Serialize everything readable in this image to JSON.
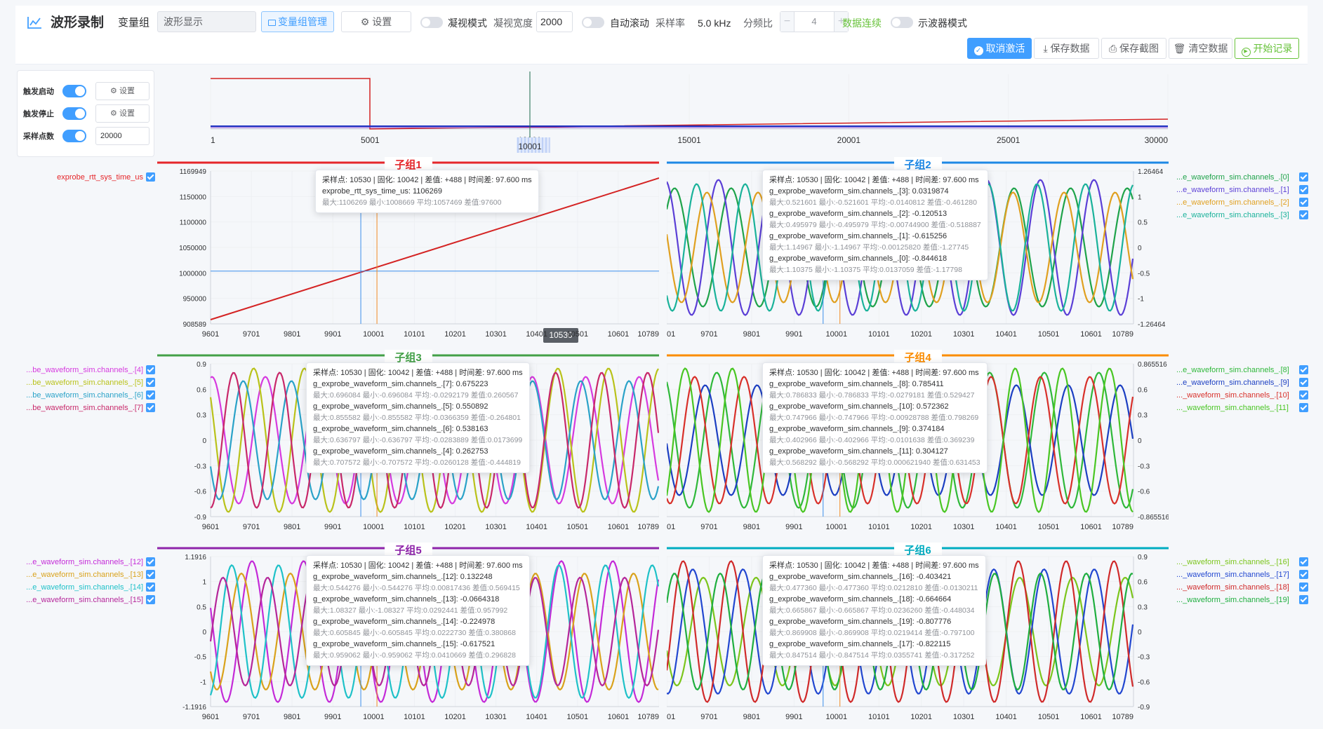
{
  "header": {
    "title": "波形录制",
    "group_label": "变量组",
    "group_value": "波形显示",
    "manage_label": "变量组管理",
    "settings_label": "设置",
    "peek_mode_label": "凝视模式",
    "peek_width_label": "凝视宽度",
    "peek_width_value": "2000",
    "auto_scroll_label": "自动滚动",
    "rate_label": "采样率",
    "rate_value": "5.0 kHz",
    "div_label": "分频比",
    "div_value": "4",
    "continuous_label": "数据连续",
    "scope_mode_label": "示波器模式",
    "cancel_label": "取消激活",
    "save_data_label": "保存数据",
    "save_shot_label": "保存截图",
    "clear_label": "清空数据",
    "start_label": "开始记录"
  },
  "trigger": {
    "start_label": "触发启动",
    "stop_label": "触发停止",
    "points_label": "采样点数",
    "points_value": "20000",
    "btn_label": "设置"
  },
  "overview": {
    "ticks": [
      "1",
      "5001",
      "10001",
      "15001",
      "20001",
      "25001",
      "30000"
    ]
  },
  "cursor_label": "10530",
  "colors": {
    "primary": "#409eff",
    "success": "#67c23a",
    "group1": "#e5262a",
    "group2": "#1e88e5",
    "group3": "#43a047",
    "group4": "#fb8c00",
    "group5": "#8e24aa",
    "group6": "#00acc1"
  },
  "groups": [
    {
      "title": "子组1",
      "yticks": [
        "1169949",
        "1150000",
        "1100000",
        "1050000",
        "1000000",
        "950000",
        "908589"
      ],
      "xticks": [
        "9601",
        "9701",
        "9801",
        "9901",
        "10001",
        "10101",
        "10201",
        "10301",
        "10401",
        "10501",
        "10601",
        "10789"
      ],
      "legend": [
        {
          "label": "exprobe_rtt_sys_time_us",
          "color": "#e5262a"
        }
      ],
      "tooltip": {
        "header": "采样点: 10530 | 固化: 10042 | 差值: +488 | 时间差: 97.600 ms",
        "items": [
          {
            "name": "exprobe_rtt_sys_time_us: 1106269",
            "stat": "最大:1106269 最小:1008669 平均:1057469 差值:97600"
          }
        ]
      }
    },
    {
      "title": "子组2",
      "yticks": [
        "1.26464",
        "1",
        "0.5",
        "0",
        "-0.5",
        "-1",
        "-1.26464"
      ],
      "xticks": [
        "9601",
        "9701",
        "9801",
        "9901",
        "10001",
        "10101",
        "10201",
        "10301",
        "10401",
        "10501",
        "10601",
        "10789"
      ],
      "legend": [
        {
          "label": "...e_waveform_sim.channels_.[0]",
          "color": "#1fa34a"
        },
        {
          "label": "...e_waveform_sim.channels_.[1]",
          "color": "#5b3fd6"
        },
        {
          "label": "...e_waveform_sim.channels_.[2]",
          "color": "#e0a020"
        },
        {
          "label": "...e_waveform_sim.channels_.[3]",
          "color": "#1ab29a"
        }
      ],
      "tooltip": {
        "header": "采样点: 10530 | 固化: 10042 | 差值: +488 | 时间差: 97.600 ms",
        "items": [
          {
            "name": "g_exprobe_waveform_sim.channels_.[3]: 0.0319874",
            "stat": "最大:0.521601 最小:-0.521601 平均:-0.0140812 差值:-0.461280"
          },
          {
            "name": "g_exprobe_waveform_sim.channels_.[2]: -0.120513",
            "stat": "最大:0.495979 最小:-0.495979 平均:-0.00744900 差值:-0.518887"
          },
          {
            "name": "g_exprobe_waveform_sim.channels_.[1]: -0.615256",
            "stat": "最大:1.14967 最小:-1.14967 平均:-0.00125820 差值:-1.27745"
          },
          {
            "name": "g_exprobe_waveform_sim.channels_.[0]: -0.844618",
            "stat": "最大:1.10375 最小:-1.10375 平均:0.0137059 差值:-1.17798"
          }
        ]
      }
    },
    {
      "title": "子组3",
      "yticks": [
        "0.9",
        "0.6",
        "0.3",
        "0",
        "-0.3",
        "-0.6",
        "-0.9"
      ],
      "xticks": [
        "9601",
        "9701",
        "9801",
        "9901",
        "10001",
        "10101",
        "10201",
        "10301",
        "10401",
        "10501",
        "10601",
        "10789"
      ],
      "legend": [
        {
          "label": "...be_waveform_sim.channels_.[4]",
          "color": "#d63adf"
        },
        {
          "label": "...be_waveform_sim.channels_.[5]",
          "color": "#b9c21a"
        },
        {
          "label": "...be_waveform_sim.channels_.[6]",
          "color": "#2aa2c8"
        },
        {
          "label": "...be_waveform_sim.channels_.[7]",
          "color": "#c8286a"
        }
      ],
      "tooltip": {
        "header": "采样点: 10530 | 固化: 10042 | 差值: +488 | 时间差: 97.600 ms",
        "items": [
          {
            "name": "g_exprobe_waveform_sim.channels_.[7]: 0.675223",
            "stat": "最大:0.696084 最小:-0.696084 平均:-0.0292179 差值:0.260567"
          },
          {
            "name": "g_exprobe_waveform_sim.channels_.[5]: 0.550892",
            "stat": "最大:0.855582 最小:-0.855582 平均:-0.0366359 差值:-0.264801"
          },
          {
            "name": "g_exprobe_waveform_sim.channels_.[6]: 0.538163",
            "stat": "最大:0.636797 最小:-0.636797 平均:-0.0283889 差值:0.0173699"
          },
          {
            "name": "g_exprobe_waveform_sim.channels_.[4]: 0.262753",
            "stat": "最大:0.707572 最小:-0.707572 平均:-0.0260128 差值:-0.444819"
          }
        ]
      }
    },
    {
      "title": "子组4",
      "yticks": [
        "0.865516",
        "0.6",
        "0.3",
        "0",
        "-0.3",
        "-0.6",
        "-0.865516"
      ],
      "xticks": [
        "9601",
        "9701",
        "9801",
        "9901",
        "10001",
        "10101",
        "10201",
        "10301",
        "10401",
        "10501",
        "10601",
        "10789"
      ],
      "legend": [
        {
          "label": "...e_waveform_sim.channels_.[8]",
          "color": "#2fb83a"
        },
        {
          "label": "...e_waveform_sim.channels_.[9]",
          "color": "#1c3fc2"
        },
        {
          "label": "..._waveform_sim.channels_.[10]",
          "color": "#d8302a"
        },
        {
          "label": "..._waveform_sim.channels_.[11]",
          "color": "#49c623"
        }
      ],
      "tooltip": {
        "header": "采样点: 10530 | 固化: 10042 | 差值: +488 | 时间差: 97.600 ms",
        "items": [
          {
            "name": "g_exprobe_waveform_sim.channels_.[8]: 0.785411",
            "stat": "最大:0.786833 最小:-0.786833 平均:-0.0279181 差值:0.529427"
          },
          {
            "name": "g_exprobe_waveform_sim.channels_.[10]: 0.572362",
            "stat": "最大:0.747966 最小:-0.747966 平均:-0.00928788 差值:0.798269"
          },
          {
            "name": "g_exprobe_waveform_sim.channels_.[9]: 0.374184",
            "stat": "最大:0.402966 最小:-0.402966 平均:-0.0101638 差值:0.369239"
          },
          {
            "name": "g_exprobe_waveform_sim.channels_.[11]: 0.304127",
            "stat": "最大:0.568292 最小:-0.568292 平均:0.000621940 差值:0.631453"
          }
        ]
      }
    },
    {
      "title": "子组5",
      "yticks": [
        "1.1916",
        "1",
        "0.5",
        "0",
        "-0.5",
        "-1",
        "-1.1916"
      ],
      "xticks": [
        "9601",
        "9701",
        "9801",
        "9901",
        "10001",
        "10101",
        "10201",
        "10301",
        "10401",
        "10501",
        "10601",
        "10789"
      ],
      "legend": [
        {
          "label": "...e_waveform_sim.channels_.[12]",
          "color": "#c42ad8"
        },
        {
          "label": "...e_waveform_sim.channels_.[13]",
          "color": "#d9a21b"
        },
        {
          "label": "...e_waveform_sim.channels_.[14]",
          "color": "#1fc1c8"
        },
        {
          "label": "...e_waveform_sim.channels_.[15]",
          "color": "#b5269a"
        }
      ],
      "tooltip": {
        "header": "采样点: 10530 | 固化: 10042 | 差值: +488 | 时间差: 97.600 ms",
        "items": [
          {
            "name": "g_exprobe_waveform_sim.channels_.[12]: 0.132248",
            "stat": "最大:0.544276 最小:-0.544276 平均:0.00817436 差值:0.569415"
          },
          {
            "name": "g_exprobe_waveform_sim.channels_.[13]: -0.0664318",
            "stat": "最大:1.08327 最小:-1.08327 平均:0.0292441 差值:0.957992"
          },
          {
            "name": "g_exprobe_waveform_sim.channels_.[14]: -0.224978",
            "stat": "最大:0.605845 最小:-0.605845 平均:0.0222730 差值:0.380868"
          },
          {
            "name": "g_exprobe_waveform_sim.channels_.[15]: -0.617521",
            "stat": "最大:0.959062 最小:-0.959062 平均:0.0410669 差值:0.296828"
          }
        ]
      }
    },
    {
      "title": "子组6",
      "yticks": [
        "0.9",
        "0.6",
        "0.3",
        "0",
        "-0.3",
        "-0.6",
        "-0.9"
      ],
      "xticks": [
        "9601",
        "9701",
        "9801",
        "9901",
        "10001",
        "10101",
        "10201",
        "10301",
        "10401",
        "10501",
        "10601",
        "10789"
      ],
      "legend": [
        {
          "label": "..._waveform_sim.channels_.[16]",
          "color": "#7bc51b"
        },
        {
          "label": "..._waveform_sim.channels_.[17]",
          "color": "#2247d0"
        },
        {
          "label": "..._waveform_sim.channels_.[18]",
          "color": "#d02a2a"
        },
        {
          "label": "..._waveform_sim.channels_.[19]",
          "color": "#1fae3f"
        }
      ],
      "tooltip": {
        "header": "采样点: 10530 | 固化: 10042 | 差值: +488 | 时间差: 97.600 ms",
        "items": [
          {
            "name": "g_exprobe_waveform_sim.channels_.[16]: -0.403421",
            "stat": "最大:0.477360 最小:-0.477360 平均:0.0212810 差值:-0.0130211"
          },
          {
            "name": "g_exprobe_waveform_sim.channels_.[18]: -0.664664",
            "stat": "最大:0.665867 最小:-0.665867 平均:0.0236260 差值:-0.448034"
          },
          {
            "name": "g_exprobe_waveform_sim.channels_.[19]: -0.807776",
            "stat": "最大:0.869908 最小:-0.869908 平均:0.0219414 差值:-0.797100"
          },
          {
            "name": "g_exprobe_waveform_sim.channels_.[17]: -0.822115",
            "stat": "最大:0.847514 最小:-0.847514 平均:0.0355741 差值:-0.317252"
          }
        ]
      }
    }
  ]
}
